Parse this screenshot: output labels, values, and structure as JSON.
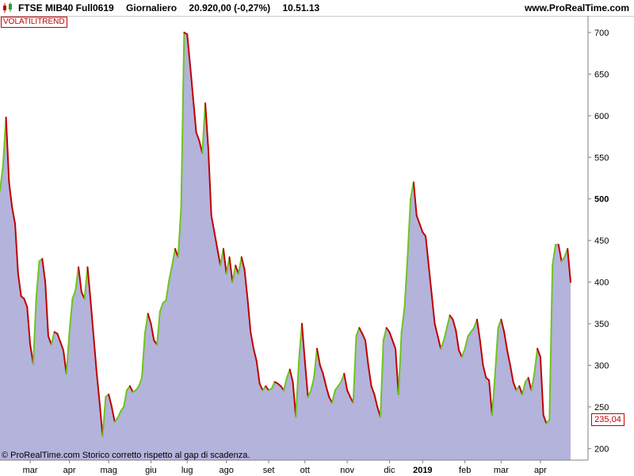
{
  "header": {
    "instrument": "FTSE MIB40 Full0619",
    "period": "Giornaliero",
    "price": "20.920,00 (-0,27%)",
    "time": "10.51.13",
    "site": "www.ProRealTime.com"
  },
  "indicator_label": "VOLATILITREND",
  "footer_note": "© ProRealTime.com  Storico corretto rispetto al gap di scadenza.",
  "last_value_label": "235,04",
  "colors": {
    "area_fill": "#b3b3dc",
    "up_line": "#6fc320",
    "down_line": "#c00000",
    "grid": "#c8c8c8",
    "label_box": "#c00000"
  },
  "chart_data": {
    "type": "area",
    "title": "VOLATILITREND",
    "xlabel": "",
    "ylabel": "",
    "ylim": [
      186,
      720
    ],
    "y_ticks": [
      200,
      250,
      300,
      350,
      400,
      450,
      500,
      550,
      600,
      650,
      700
    ],
    "y_tick_bold": [
      500
    ],
    "x_ticks": [
      {
        "label": "mar",
        "index": 10
      },
      {
        "label": "apr",
        "index": 23
      },
      {
        "label": "mag",
        "index": 36
      },
      {
        "label": "giu",
        "index": 50
      },
      {
        "label": "lug",
        "index": 62
      },
      {
        "label": "ago",
        "index": 75
      },
      {
        "label": "set",
        "index": 89
      },
      {
        "label": "ott",
        "index": 101
      },
      {
        "label": "nov",
        "index": 115
      },
      {
        "label": "dic",
        "index": 129
      },
      {
        "label": "2019",
        "index": 140,
        "bold": true
      },
      {
        "label": "feb",
        "index": 154
      },
      {
        "label": "mar",
        "index": 166
      },
      {
        "label": "apr",
        "index": 179
      }
    ],
    "last_value": 235.04,
    "series": [
      {
        "name": "VOLATILITREND",
        "values": [
          510,
          540,
          598,
          520,
          490,
          470,
          410,
          383,
          380,
          370,
          325,
          302,
          380,
          425,
          428,
          400,
          335,
          325,
          340,
          338,
          328,
          318,
          290,
          340,
          380,
          390,
          418,
          388,
          380,
          418,
          378,
          335,
          292,
          255,
          215,
          262,
          265,
          250,
          232,
          237,
          245,
          250,
          270,
          275,
          268,
          270,
          275,
          285,
          338,
          362,
          350,
          330,
          325,
          365,
          375,
          378,
          402,
          420,
          440,
          430,
          490,
          700,
          698,
          660,
          620,
          580,
          570,
          555,
          615,
          560,
          480,
          460,
          440,
          420,
          440,
          410,
          430,
          400,
          420,
          410,
          430,
          415,
          380,
          340,
          320,
          305,
          278,
          270,
          275,
          270,
          272,
          280,
          278,
          275,
          270,
          285,
          295,
          280,
          238,
          305,
          350,
          305,
          262,
          270,
          285,
          320,
          300,
          290,
          275,
          262,
          255,
          270,
          275,
          280,
          290,
          270,
          262,
          255,
          335,
          345,
          338,
          330,
          300,
          275,
          265,
          250,
          238,
          330,
          345,
          340,
          330,
          320,
          265,
          340,
          370,
          430,
          500,
          520,
          480,
          470,
          460,
          455,
          420,
          385,
          350,
          335,
          320,
          330,
          345,
          360,
          355,
          342,
          318,
          310,
          320,
          335,
          340,
          345,
          355,
          330,
          300,
          285,
          282,
          240,
          290,
          345,
          355,
          340,
          318,
          300,
          280,
          270,
          275,
          265,
          280,
          285,
          270,
          290,
          320,
          310,
          240,
          230,
          235,
          420,
          445,
          445,
          425,
          430,
          440,
          400
        ]
      }
    ]
  }
}
